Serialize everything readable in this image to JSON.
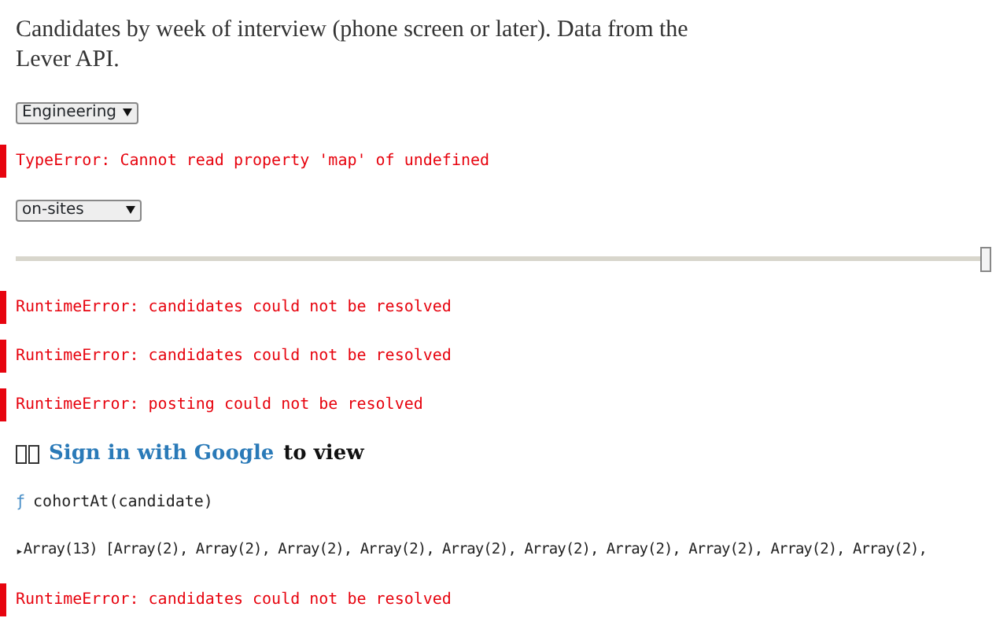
{
  "cells": [
    {
      "kind": "text",
      "text": "Candidates by week of interview (phone screen or later). Data from the Lever API."
    },
    {
      "kind": "select",
      "value": "Engineering"
    },
    {
      "kind": "error",
      "text": "TypeError: Cannot read property 'map' of undefined"
    },
    {
      "kind": "select",
      "value": "on-sites"
    },
    {
      "kind": "slider",
      "level": 1
    },
    {
      "kind": "error",
      "text": "RuntimeError: candidates could not be resolved"
    },
    {
      "kind": "error",
      "text": "RuntimeError: candidates could not be resolved"
    },
    {
      "kind": "error",
      "text": "RuntimeError: posting could not be resolved"
    },
    {
      "kind": "signin",
      "link": "Sign in with Google",
      "text": "to view"
    },
    {
      "kind": "function",
      "glyph": "ƒ",
      "text": "cohortAt(candidate)"
    },
    {
      "kind": "array",
      "glyph": "▸",
      "text": "Array(13) [Array(2), Array(2), Array(2), Array(2), Array(2), Array(2), Array(2), Array(2), Array(2), Array(2),"
    },
    {
      "kind": "error",
      "text": "RuntimeError: candidates could not be resolved"
    }
  ]
}
